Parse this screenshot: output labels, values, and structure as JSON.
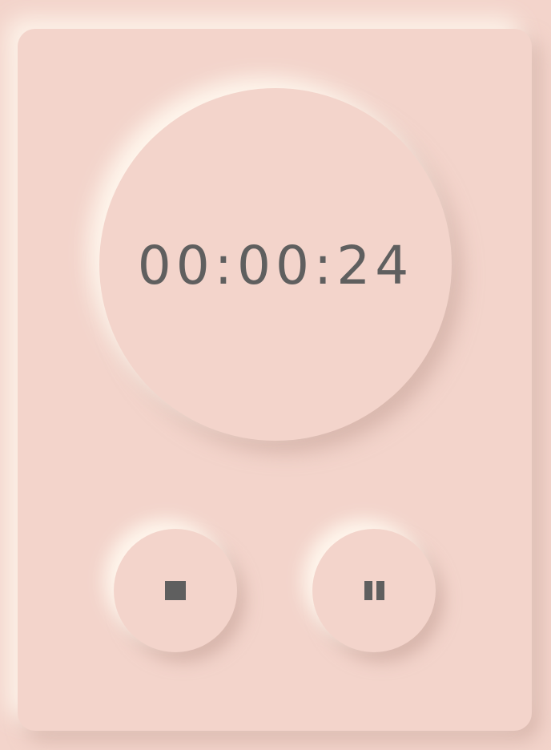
{
  "timer": {
    "display": "00:00:24"
  },
  "controls": {
    "stop_icon": "stop-icon",
    "pause_icon": "pause-icon"
  },
  "colors": {
    "background": "#f3d4cb",
    "text": "#5f5f5f",
    "highlight": "#fff8ee",
    "shadow": "#c4a096"
  }
}
